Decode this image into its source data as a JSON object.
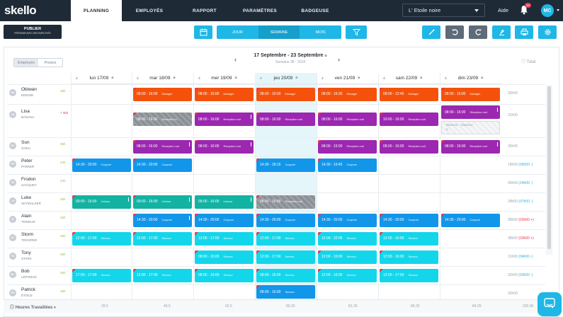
{
  "app": {
    "logo": "skello"
  },
  "nav": [
    {
      "label": "PLANNING",
      "active": true
    },
    {
      "label": "EMPLOYÉS",
      "active": false
    },
    {
      "label": "RAPPORT",
      "active": false
    },
    {
      "label": "PARAMÈTRES",
      "active": false
    },
    {
      "label": "BADGEUSE",
      "active": false
    }
  ],
  "header": {
    "site_select": "L' Etoile noire",
    "help": "Aide",
    "notifications": "22",
    "avatar": "MC"
  },
  "toolbar": {
    "publish_title": "PUBLIER",
    "publish_sub": "PRÉVENIR AVEC DES EMPLOYÉS",
    "views": [
      {
        "label": "JOUR",
        "active": false
      },
      {
        "label": "SEMAINE",
        "active": true
      },
      {
        "label": "MOIS",
        "active": false
      }
    ]
  },
  "planning": {
    "toggle": [
      {
        "label": "Employés",
        "active": true
      },
      {
        "label": "Postes",
        "active": false
      }
    ],
    "week_range": "17 Septembre - 23 Septembre",
    "week_sub": "Semaine 38 - 2018",
    "total_label": "Total",
    "days": [
      {
        "label": "lun 17/09",
        "today": false
      },
      {
        "label": "mar 18/09",
        "today": false
      },
      {
        "label": "mer 19/09",
        "today": false
      },
      {
        "label": "jeu 20/09",
        "today": true
      },
      {
        "label": "ven 21/09",
        "today": false
      },
      {
        "label": "sam 22/09",
        "today": false
      },
      {
        "label": "dim 23/09",
        "today": false
      }
    ],
    "employees": [
      {
        "initials": "OK",
        "first": "Obiwan",
        "last": "KENOBI",
        "hours": "39h",
        "total": "39h00",
        "delta": ""
      },
      {
        "initials": "LB",
        "first": "Lisa",
        "last": "BANANA",
        "hours": "? 35h",
        "total": "31h00",
        "delta": ""
      },
      {
        "initials": "SG",
        "first": "Son",
        "last": "GOKU",
        "hours": "35h",
        "total": "35h00",
        "delta": ""
      },
      {
        "initials": "PP",
        "first": "Peter",
        "last": "PARKER",
        "hours": "24h",
        "total": "19h00",
        "delta": "(05h00 -)"
      },
      {
        "initials": "FS",
        "first": "Frodon",
        "last": "SACQUET",
        "hours": "24h",
        "total": "00h00",
        "delta": "(24h00 -)"
      },
      {
        "initials": "LS",
        "first": "Luke",
        "last": "SKYWALKER",
        "hours": "35h",
        "total": "28h00",
        "delta": "(07h00 -)"
      },
      {
        "initials": "AT",
        "first": "Alain",
        "last": "TERIEUR",
        "hours": "35h",
        "total": "38h00",
        "delta": "(03h00 +)"
      },
      {
        "initials": "ST",
        "first": "Storm",
        "last": "TROOPER",
        "hours": "35h",
        "total": "38h00",
        "delta": "(03h00 +)"
      },
      {
        "initials": "TS",
        "first": "Tony",
        "last": "STARK",
        "hours": "35h",
        "total": "31h00",
        "delta": "(04h00 -)"
      },
      {
        "initials": "BL",
        "first": "Bob",
        "last": "LÉPONGE",
        "hours": "35h",
        "total": "32h00",
        "delta": "(03h00 -)"
      },
      {
        "initials": "PR",
        "first": "Patrick",
        "last": "ÉTOILE",
        "hours": "35h",
        "total": "35h00",
        "delta": ""
      }
    ],
    "shifts": [
      {
        "row": 0,
        "day": 1,
        "time": "08:00 - 16:00",
        "tag": "Manager",
        "color": "orange",
        "flag": true
      },
      {
        "row": 0,
        "day": 2,
        "time": "08:00 - 16:00",
        "tag": "Manager",
        "color": "orange",
        "flag": true
      },
      {
        "row": 0,
        "day": 3,
        "time": "08:00 - 15:00",
        "tag": "Manager",
        "color": "orange",
        "flag": true
      },
      {
        "row": 0,
        "day": 4,
        "time": "08:00 - 16:30",
        "tag": "Manager",
        "color": "orange",
        "flag": true
      },
      {
        "row": 0,
        "day": 5,
        "time": "08:00 - 12:45",
        "tag": "Manager",
        "color": "orange",
        "flag": true
      },
      {
        "row": 0,
        "day": 6,
        "time": "08:00 - 16:00",
        "tag": "Manager",
        "color": "orange",
        "flag": true
      },
      {
        "row": 1,
        "day": 1,
        "time": "08:00 - 16:00",
        "tag": "Réception hi...",
        "color": "hatch",
        "flag": true
      },
      {
        "row": 1,
        "day": 2,
        "time": "08:00 - 16:00",
        "tag": "Reception nuit",
        "color": "purple",
        "flag": true,
        "bang": true
      },
      {
        "row": 1,
        "day": 3,
        "time": "08:00 - 16:00",
        "tag": "Réception nuit",
        "color": "purple",
        "flag": true
      },
      {
        "row": 1,
        "day": 4,
        "time": "08:00 - 16:00",
        "tag": "Réception nuit",
        "color": "purple",
        "flag": true
      },
      {
        "row": 1,
        "day": 5,
        "time": "10:00 - 16:00",
        "tag": "Réception nuit",
        "color": "purple",
        "flag": true
      },
      {
        "row": 1,
        "day": 6,
        "time": "08:00 - 16:00",
        "tag": "Réception nuit",
        "color": "purple",
        "bang": true,
        "half": "top"
      },
      {
        "row": 1,
        "day": 6,
        "time": "Absence - Absence",
        "tag": "7h",
        "color": "absent",
        "half": "bottom"
      },
      {
        "row": 2,
        "day": 1,
        "time": "08:00 - 16:00",
        "tag": "Réception nuit",
        "color": "purple",
        "flag": true,
        "bang": true
      },
      {
        "row": 2,
        "day": 2,
        "time": "08:00 - 16:00",
        "tag": "Réception nuit",
        "color": "purple",
        "flag": true,
        "bang": true
      },
      {
        "row": 2,
        "day": 4,
        "time": "08:00 - 15:00",
        "tag": "Réception nuit",
        "color": "purple",
        "flag": true
      },
      {
        "row": 2,
        "day": 5,
        "time": "08:00 - 16:00",
        "tag": "Réception nuit",
        "color": "purple",
        "flag": true
      },
      {
        "row": 2,
        "day": 6,
        "time": "08:00 - 16:00",
        "tag": "Réception nuit",
        "color": "purple",
        "flag": true,
        "bang": true
      },
      {
        "row": 3,
        "day": 0,
        "time": "14:30 - 20:00",
        "tag": "Coupure",
        "color": "blue",
        "flag": true
      },
      {
        "row": 3,
        "day": 1,
        "time": "14:30 - 20:00",
        "tag": "Coupure",
        "color": "blue",
        "flag": true
      },
      {
        "row": 3,
        "day": 3,
        "time": "14:30 - 18:15",
        "tag": "Coupure",
        "color": "blue",
        "flag": true
      },
      {
        "row": 3,
        "day": 4,
        "time": "14:30 - 19:45",
        "tag": "Coupure",
        "color": "blue",
        "flag": true
      },
      {
        "row": 5,
        "day": 0,
        "time": "09:00 - 16:00",
        "tag": "Linéaur",
        "color": "teal",
        "flag": true,
        "bang": true
      },
      {
        "row": 5,
        "day": 1,
        "time": "09:00 - 16:00",
        "tag": "Linéaur",
        "color": "teal",
        "flag": true,
        "bang": true
      },
      {
        "row": 5,
        "day": 2,
        "time": "09:00 - 16:00",
        "tag": "Linéaur",
        "color": "teal",
        "bang": true
      },
      {
        "row": 5,
        "day": 3,
        "time": "08:00 - 16:00",
        "tag": "Réception nuit",
        "color": "hatch",
        "flag": true
      },
      {
        "row": 6,
        "day": 1,
        "time": "14:30 - 20:00",
        "tag": "Coupure",
        "color": "blue",
        "flag": true,
        "bang": true
      },
      {
        "row": 6,
        "day": 2,
        "time": "14:30 - 20:00",
        "tag": "Coupure",
        "color": "blue",
        "flag": true
      },
      {
        "row": 6,
        "day": 3,
        "time": "14:30 - 20:00",
        "tag": "Coupure",
        "color": "blue",
        "flag": true
      },
      {
        "row": 6,
        "day": 4,
        "time": "14:30 - 20:00",
        "tag": "Coupure",
        "color": "blue",
        "flag": true
      },
      {
        "row": 6,
        "day": 5,
        "time": "14:30 - 20:00",
        "tag": "Coupure",
        "color": "blue",
        "flag": true
      },
      {
        "row": 6,
        "day": 6,
        "time": "14:30 - 20:00",
        "tag": "Coupure",
        "color": "blue",
        "flag": true
      },
      {
        "row": 7,
        "day": 0,
        "time": "12:00 - 17:00",
        "tag": "Serveur",
        "color": "cyan",
        "flag": true
      },
      {
        "row": 7,
        "day": 1,
        "time": "12:00 - 17:00",
        "tag": "Serveur",
        "color": "cyan",
        "flag": true
      },
      {
        "row": 7,
        "day": 2,
        "time": "12:00 - 17:00",
        "tag": "Serveur",
        "color": "cyan",
        "flag": true
      },
      {
        "row": 7,
        "day": 3,
        "time": "12:00 - 17:00",
        "tag": "Serveur",
        "color": "cyan",
        "flag": true
      },
      {
        "row": 7,
        "day": 4,
        "time": "12:00 - 22:00",
        "tag": "Serveur",
        "color": "cyan",
        "flag": true
      },
      {
        "row": 7,
        "day": 5,
        "time": "12:00 - 16:00",
        "tag": "Serveur",
        "color": "cyan",
        "flag": true
      },
      {
        "row": 8,
        "day": 2,
        "time": "08:00 - 16:00",
        "tag": "Serveur",
        "color": "cyan",
        "flag": true
      },
      {
        "row": 8,
        "day": 3,
        "time": "12:00 - 17:00",
        "tag": "Serveur",
        "color": "cyan",
        "flag": true
      },
      {
        "row": 8,
        "day": 4,
        "time": "12:00 - 16:00",
        "tag": "Serveur",
        "color": "cyan",
        "flag": true
      },
      {
        "row": 8,
        "day": 5,
        "time": "12:00 - 16:00",
        "tag": "Serveur",
        "color": "cyan",
        "flag": true
      },
      {
        "row": 9,
        "day": 0,
        "time": "17:00 - 17:00",
        "tag": "Serveur",
        "color": "cyan",
        "flag": true
      },
      {
        "row": 9,
        "day": 1,
        "time": "12:00 - 17:00",
        "tag": "Serveur",
        "color": "cyan",
        "flag": true
      },
      {
        "row": 9,
        "day": 2,
        "time": "08:00 - 16:00",
        "tag": "Serveur",
        "color": "cyan",
        "flag": true
      },
      {
        "row": 9,
        "day": 3,
        "time": "08:00 - 16:00",
        "tag": "Serveur",
        "color": "cyan",
        "flag": true
      },
      {
        "row": 9,
        "day": 4,
        "time": "12:00 - 16:00",
        "tag": "Serveur",
        "color": "cyan",
        "flag": true
      },
      {
        "row": 9,
        "day": 5,
        "time": "12:00 - 17:00",
        "tag": "Serveur",
        "color": "cyan",
        "flag": true
      },
      {
        "row": 10,
        "day": 3,
        "time": "08:00 - 16:00",
        "tag": "Serveur",
        "color": "blue",
        "flag": true
      }
    ]
  },
  "footer": {
    "label": "Heures Travaillées",
    "values": [
      "28.5",
      "49.5",
      "62.5",
      "80.25",
      "81.25",
      "86.25",
      "84.25",
      "230.00"
    ]
  }
}
